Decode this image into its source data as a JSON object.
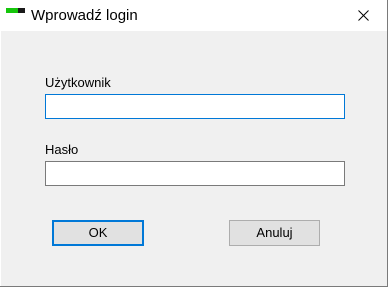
{
  "window": {
    "title": "Wprowadź login",
    "icon": "app-icon",
    "close_icon": "close-icon"
  },
  "form": {
    "username_label": "Użytkownik",
    "username_value": "",
    "password_label": "Hasło",
    "password_value": ""
  },
  "buttons": {
    "ok_label": "OK",
    "cancel_label": "Anuluj"
  },
  "colors": {
    "accent": "#0078d7",
    "client_background": "#f0f0f0",
    "button_face": "#e1e1e1"
  }
}
